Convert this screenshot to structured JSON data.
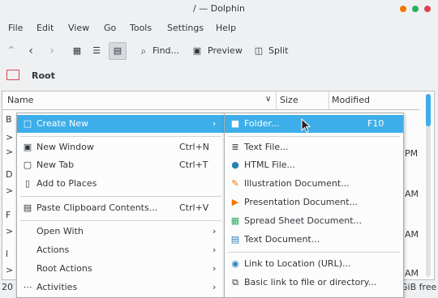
{
  "window": {
    "title": "/ — Dolphin"
  },
  "menubar": [
    "File",
    "Edit",
    "View",
    "Go",
    "Tools",
    "Settings",
    "Help"
  ],
  "toolbar": {
    "find": "Find...",
    "preview": "Preview",
    "split": "Split"
  },
  "location": {
    "label": "Root"
  },
  "columns": {
    "name": "Name",
    "size": "Size",
    "modified": "Modified"
  },
  "rows_partial": {
    "left": [
      "B",
      ">",
      ">",
      "D",
      ">",
      "F",
      ">",
      "l",
      ">"
    ],
    "right": [
      "PM",
      "AM",
      "AM",
      "AM"
    ]
  },
  "status": {
    "left": "20 F",
    "right": "GiB free"
  },
  "context_menu": {
    "items": [
      {
        "label": "Create New",
        "icon": "new-document-icon",
        "submenu": true,
        "highlighted": true
      },
      {
        "label": "New Window",
        "shortcut": "Ctrl+N",
        "icon": "new-window-icon"
      },
      {
        "label": "New Tab",
        "shortcut": "Ctrl+T",
        "icon": "new-tab-icon"
      },
      {
        "label": "Add to Places",
        "icon": "bookmark-icon"
      },
      {
        "label": "Paste Clipboard Contents...",
        "shortcut": "Ctrl+V",
        "icon": "paste-icon"
      },
      {
        "label": "Open With",
        "submenu": true
      },
      {
        "label": "Actions",
        "submenu": true
      },
      {
        "label": "Root Actions",
        "submenu": true
      },
      {
        "label": "Activities",
        "submenu": true,
        "icon": "more-icon"
      }
    ]
  },
  "create_new_submenu": {
    "items": [
      {
        "label": "Folder...",
        "shortcut": "F10",
        "icon": "folder-icon",
        "highlighted": true
      },
      {
        "label": "Text File...",
        "icon": "text-file-icon"
      },
      {
        "label": "HTML File...",
        "icon": "html-file-icon"
      },
      {
        "label": "Illustration Document...",
        "icon": "illustration-icon"
      },
      {
        "label": "Presentation Document...",
        "icon": "presentation-icon"
      },
      {
        "label": "Spread Sheet Document...",
        "icon": "spreadsheet-icon"
      },
      {
        "label": "Text Document...",
        "icon": "text-document-icon"
      },
      {
        "label": "Link to Location (URL)...",
        "icon": "link-url-icon"
      },
      {
        "label": "Basic link to file or directory...",
        "icon": "link-file-icon"
      }
    ]
  },
  "colors": {
    "accent": "#3daee9",
    "window": "#eff0f1",
    "text": "#31363b",
    "close": "#da4453",
    "maximize": "#27ae60",
    "minimize": "#f67400"
  }
}
